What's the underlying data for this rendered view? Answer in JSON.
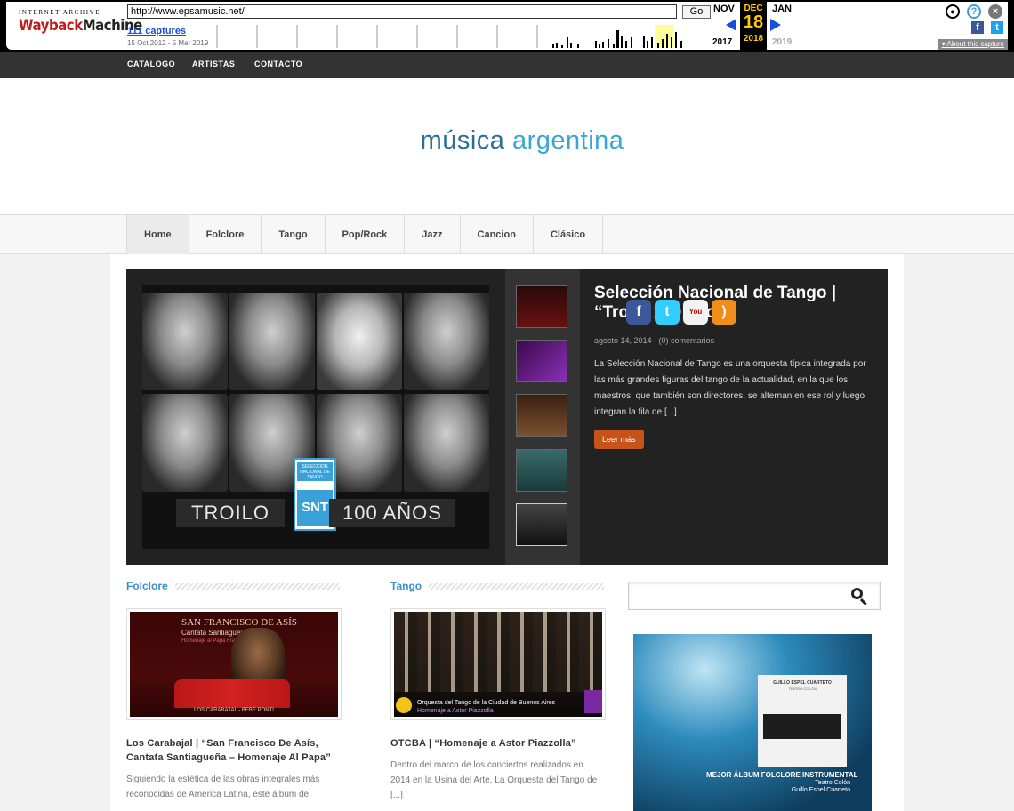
{
  "wayback": {
    "logo_top": "INTERNET ARCHIVE",
    "logo_main_a": "Wayback",
    "logo_main_b": "Machine",
    "url": "http://www.epsamusic.net/",
    "go_label": "Go",
    "captures": "111 captures",
    "date_range": "15 Oct 2012 - 5 Mar 2019",
    "prev_month": "NOV",
    "cur_month": "DEC",
    "next_month": "JAN",
    "cur_day": "18",
    "prev_year": "2017",
    "cur_year": "2018",
    "next_year": "2019",
    "about": "About this capture",
    "icons": [
      "user-icon",
      "help-icon",
      "close-icon",
      "facebook-icon",
      "twitter-icon"
    ]
  },
  "topnav": [
    "CATALOGO",
    "ARTISTAS",
    "CONTACTO"
  ],
  "site": {
    "title_a": "música",
    "title_b": "argentina",
    "colors": {
      "title": "#2d6e99",
      "accent": "#3ba6d6",
      "button": "#c7531b"
    }
  },
  "catnav": [
    "Home",
    "Folclore",
    "Tango",
    "Pop/Rock",
    "Jazz",
    "Cancion",
    "Clásico"
  ],
  "slider": {
    "title_line1": "Selección Nacional de Tango |",
    "title_line2": "“Troilo 100 años”",
    "meta": "agosto 14, 2014 - (0) comentarios",
    "excerpt": "La Selección Nacional de Tango es una orquesta típica integrada por las más grandes figuras del tango de la actualidad, en la que los maestros, que también son directores, se alternan en ese rol y luego integran la fila de [...]",
    "button": "Leer más",
    "image_left": "TROILO",
    "image_right": "100 AÑOS",
    "image_badge": "SNT",
    "image_badge_top": "SELECCION NACIONAL DE TANGO",
    "social": [
      "facebook-icon",
      "twitter-icon",
      "youtube-icon",
      "rss-icon"
    ]
  },
  "columns": [
    {
      "heading": "Folclore",
      "title": "Los Carabajal | “San Francisco De Asís, Cantata Santiagueña – Homenaje Al Papa”",
      "text": "Siguiendo la estética de las obras integrales más reconocidas de América Latina, este álbum de",
      "image_title": "SAN FRANCISCO DE ASÍS",
      "image_sub": "Cantata Santiagueña",
      "image_sub2": "Homenaje al Papa Francisco",
      "image_foot": "LOS CARABAJAL - BEBE PONTI"
    },
    {
      "heading": "Tango",
      "title": "OTCBA | “Homenaje a Astor Piazzolla”",
      "text": "Dentro del marco de los conciertos realizados en 2014 en la Usina del Arte, La Orquesta del Tango de [...]",
      "image_title": "Orquesta del Tango de la Ciudad de Buenos Aires",
      "image_sub": "Homenaje a Astor Piazzolla"
    }
  ],
  "sidebar": {
    "search_placeholder": "",
    "ad_album_head": "GUILLO ESPEL CUARTETO",
    "ad_album_sub": "TEATRO COLÓN",
    "ad_title": "MEJOR ÁLBUM FOLCLORE INSTRUMENTAL",
    "ad_venue": "Teatro Colón",
    "ad_group": "Guillo Espel Cuarteto"
  }
}
